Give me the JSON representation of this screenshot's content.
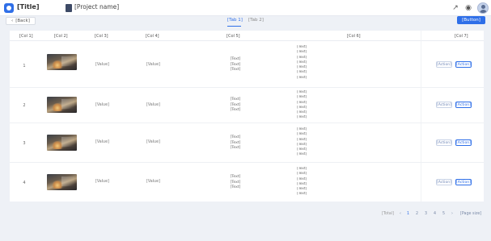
{
  "topbar": {
    "app_title": "[Title]",
    "project_title": "[Project name]"
  },
  "toolbar": {
    "back_label": "[Back]",
    "primary_button": "[Button]",
    "tabs": [
      {
        "label": "[Tab 1]",
        "active": true
      },
      {
        "label": "[Tab 2]",
        "active": false
      }
    ]
  },
  "table": {
    "headers": [
      "[Col 1]",
      "[Col 2]",
      "[Col 3]",
      "[Col 4]",
      "[Col 5]",
      "[Col 6]",
      "[Col 7]"
    ],
    "rows": [
      {
        "index": "1",
        "col3": "[Value]",
        "col4": "[Value]",
        "desc": [
          "[Text]",
          "[Text]",
          "[Text]"
        ],
        "detail": [
          "[Text]",
          "[Text]",
          "[Text]",
          "[Text]",
          "[Text]",
          "[Text]",
          "[Text]"
        ],
        "ops": [
          "[Action]",
          "[Action]"
        ]
      },
      {
        "index": "2",
        "col3": "[Value]",
        "col4": "[Value]",
        "desc": [
          "[Text]",
          "[Text]",
          "[Text]"
        ],
        "detail": [
          "[Text]",
          "[Text]",
          "[Text]",
          "[Text]",
          "[Text]",
          "[Text]"
        ],
        "ops": [
          "[Action]",
          "[Action]"
        ]
      },
      {
        "index": "3",
        "col3": "[Value]",
        "col4": "[Value]",
        "desc": [
          "[Text]",
          "[Text]",
          "[Text]"
        ],
        "detail": [
          "[Text]",
          "[Text]",
          "[Text]",
          "[Text]",
          "[Text]",
          "[Text]"
        ],
        "ops": [
          "[Action]",
          "[Action]"
        ]
      },
      {
        "index": "4",
        "col3": "[Value]",
        "col4": "[Value]",
        "desc": [
          "[Text]",
          "[Text]",
          "[Text]"
        ],
        "detail": [
          "[Text]",
          "[Text]",
          "[Text]",
          "[Text]",
          "[Text]",
          "[Text]"
        ],
        "ops": [
          "[Action]",
          "[Action]"
        ]
      }
    ]
  },
  "pagination": {
    "total_label": "[Total]",
    "pages": [
      "1",
      "2",
      "3",
      "4",
      "5"
    ],
    "current_page": "1",
    "prev_icon": "chevron-left-icon",
    "next_icon": "chevron-right-icon",
    "page_size_label": "[Page size]"
  },
  "colors": {
    "accent": "#2f6fe8",
    "background": "#eef1f6"
  }
}
